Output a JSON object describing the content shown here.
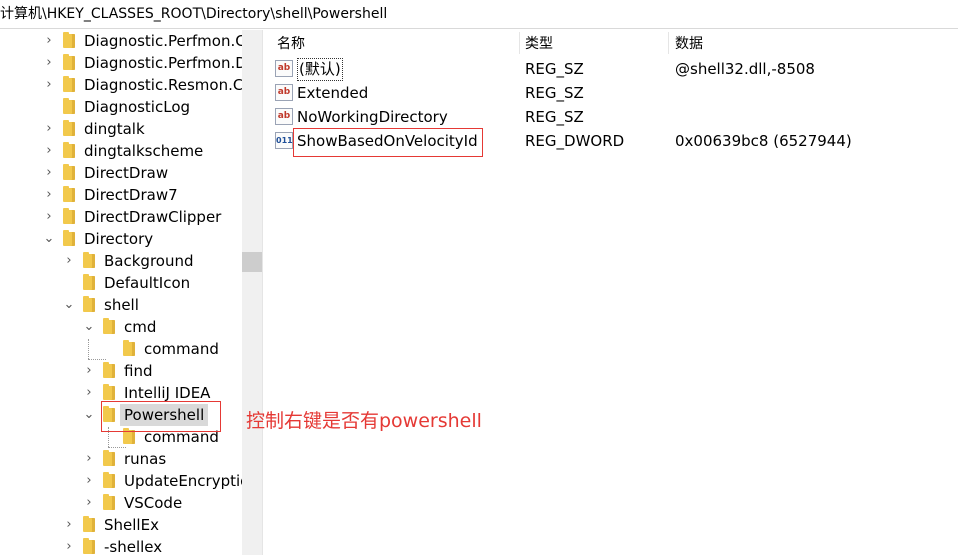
{
  "address": "计算机\\HKEY_CLASSES_ROOT\\Directory\\shell\\Powershell",
  "tree": [
    {
      "label": "Diagnostic.Perfmon.C",
      "expander": "›"
    },
    {
      "label": "Diagnostic.Perfmon.D",
      "expander": "›"
    },
    {
      "label": "Diagnostic.Resmon.Co",
      "expander": "›"
    },
    {
      "label": "DiagnosticLog",
      "expander": ""
    },
    {
      "label": "dingtalk",
      "expander": "›"
    },
    {
      "label": "dingtalkscheme",
      "expander": "›"
    },
    {
      "label": "DirectDraw",
      "expander": "›"
    },
    {
      "label": "DirectDraw7",
      "expander": "›"
    },
    {
      "label": "DirectDrawClipper",
      "expander": "›"
    },
    {
      "label": "Directory",
      "expander": "⌄"
    },
    {
      "label": "Background",
      "expander": "›"
    },
    {
      "label": "DefaultIcon",
      "expander": ""
    },
    {
      "label": "shell",
      "expander": "⌄"
    },
    {
      "label": "cmd",
      "expander": "⌄"
    },
    {
      "label": "command",
      "expander": ""
    },
    {
      "label": "find",
      "expander": "›"
    },
    {
      "label": "IntelliJ IDEA",
      "expander": "›"
    },
    {
      "label": "Powershell",
      "expander": "⌄"
    },
    {
      "label": "command",
      "expander": ""
    },
    {
      "label": "runas",
      "expander": "›"
    },
    {
      "label": "UpdateEncryptio",
      "expander": "›"
    },
    {
      "label": "VSCode",
      "expander": "›"
    },
    {
      "label": "ShellEx",
      "expander": "›"
    },
    {
      "label": "-shellex",
      "expander": "›"
    }
  ],
  "columns": {
    "name": "名称",
    "type": "类型",
    "data": "数据"
  },
  "values": [
    {
      "icon": "string-value-icon",
      "glyph": "ab",
      "name": "(默认)",
      "type": "REG_SZ",
      "data": "@shell32.dll,-8508"
    },
    {
      "icon": "string-value-icon",
      "glyph": "ab",
      "name": "Extended",
      "type": "REG_SZ",
      "data": ""
    },
    {
      "icon": "string-value-icon",
      "glyph": "ab",
      "name": "NoWorkingDirectory",
      "type": "REG_SZ",
      "data": ""
    },
    {
      "icon": "dword-value-icon",
      "glyph": "011",
      "name": "ShowBasedOnVelocityId",
      "type": "REG_DWORD",
      "data": "0x00639bc8 (6527944)"
    }
  ],
  "annotation": "控制右键是否有powershell",
  "colors": {
    "annotation_red": "#e53935",
    "folder": "#f2c94c",
    "selection": "#d9d9d9"
  }
}
